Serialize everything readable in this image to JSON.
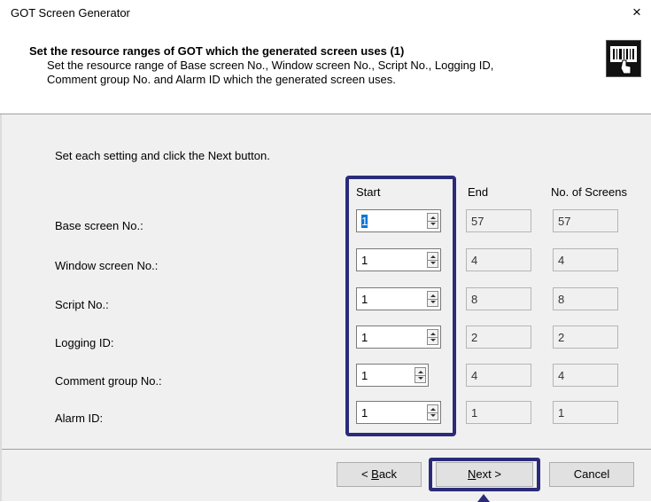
{
  "window": {
    "title": "GOT Screen Generator",
    "close_glyph": "×"
  },
  "header": {
    "title": "Set the resource ranges of GOT which the generated screen uses (1)",
    "desc_line1": "Set the resource range of Base screen No., Window screen No., Script No., Logging ID,",
    "desc_line2": "Comment group No. and Alarm ID which the generated screen uses.",
    "logo_icon": "barcode-hand-icon"
  },
  "instruction": "Set each setting and click the Next button.",
  "columns": {
    "start": "Start",
    "end": "End",
    "screens": "No. of Screens"
  },
  "rows": [
    {
      "label": "Base screen No.:",
      "start": "1",
      "end": "57",
      "screens": "57"
    },
    {
      "label": "Window screen No.:",
      "start": "1",
      "end": "4",
      "screens": "4"
    },
    {
      "label": "Script No.:",
      "start": "1",
      "end": "8",
      "screens": "8"
    },
    {
      "label": "Logging ID:",
      "start": "1",
      "end": "2",
      "screens": "2"
    },
    {
      "label": "Comment group No.:",
      "start": "1",
      "end": "4",
      "screens": "4"
    },
    {
      "label": "Alarm ID:",
      "start": "1",
      "end": "1",
      "screens": "1"
    }
  ],
  "buttons": {
    "back": {
      "mnemonic": "B",
      "rest": "ack",
      "prefix": "< "
    },
    "next": {
      "mnemonic": "N",
      "rest": "ext >"
    },
    "cancel": "Cancel"
  },
  "colors": {
    "highlight": "#2b2b7a"
  }
}
